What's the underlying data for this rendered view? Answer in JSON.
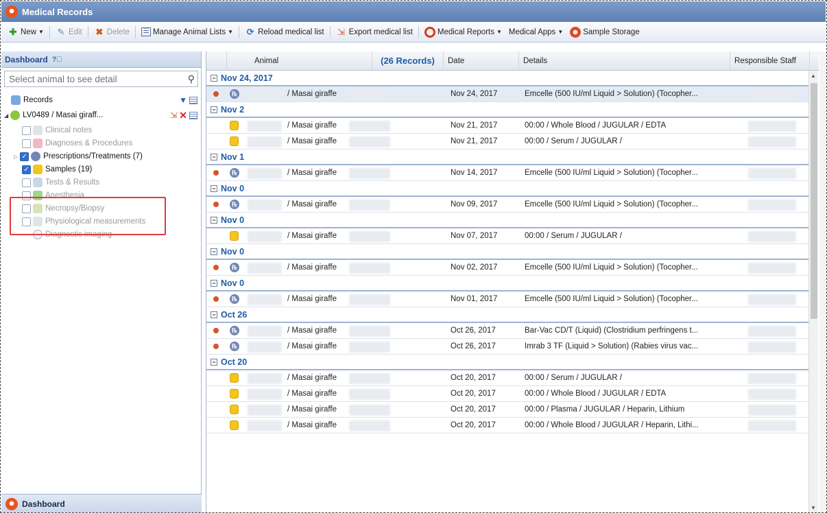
{
  "window": {
    "title": "Medical Records"
  },
  "toolbar": {
    "new": "New",
    "edit": "Edit",
    "delete": "Delete",
    "manage": "Manage Animal Lists",
    "reload": "Reload medical list",
    "export": "Export medical list",
    "reports": "Medical Reports",
    "apps": "Medical Apps",
    "storage": "Sample Storage"
  },
  "left": {
    "title": "Dashboard",
    "search_placeholder": "Select animal to see detail",
    "records_label": "Records",
    "animal_label": "LV0489 / Masai giraff...",
    "categories": [
      {
        "label": "Clinical notes",
        "checked": false
      },
      {
        "label": "Diagnoses & Procedures",
        "checked": false
      },
      {
        "label": "Prescriptions/Treatments (7)",
        "checked": true
      },
      {
        "label": "Samples (19)",
        "checked": true
      },
      {
        "label": "Tests & Results",
        "checked": false
      },
      {
        "label": "Anesthesia",
        "checked": false
      },
      {
        "label": "Necropsy/Biopsy",
        "checked": false
      },
      {
        "label": "Physiological measurements",
        "checked": false
      },
      {
        "label": "Diagnostic imaging",
        "checked": false
      }
    ],
    "footer": "Dashboard"
  },
  "grid": {
    "columns": {
      "animal": "Animal",
      "count": "(26 Records)",
      "date": "Date",
      "details": "Details",
      "staff": "Responsible Staff"
    },
    "groups": [
      {
        "label": "Nov 24, 2017",
        "rows": [
          {
            "type": "rx",
            "animal": "/ Masai giraffe",
            "date": "Nov 24, 2017",
            "details": "Emcelle (500 IU/ml Liquid > Solution) (Tocopher...",
            "selected": true
          }
        ]
      },
      {
        "label": "Nov 2",
        "rows": [
          {
            "type": "sample",
            "animal": "/ Masai giraffe",
            "date": "Nov 21, 2017",
            "details": "00:00 / Whole Blood / JUGULAR / EDTA"
          },
          {
            "type": "sample",
            "animal": "/ Masai giraffe",
            "date": "Nov 21, 2017",
            "details": "00:00 / Serum / JUGULAR /"
          }
        ]
      },
      {
        "label": "Nov 1",
        "rows": [
          {
            "type": "rx",
            "animal": "/ Masai giraffe",
            "date": "Nov 14, 2017",
            "details": "Emcelle (500 IU/ml Liquid > Solution) (Tocopher..."
          }
        ]
      },
      {
        "label": "Nov 0",
        "rows": [
          {
            "type": "rx",
            "animal": "/ Masai giraffe",
            "date": "Nov 09, 2017",
            "details": "Emcelle (500 IU/ml Liquid > Solution) (Tocopher..."
          }
        ]
      },
      {
        "label": "Nov 0",
        "rows": [
          {
            "type": "sample",
            "animal": "/ Masai giraffe",
            "date": "Nov 07, 2017",
            "details": "00:00 / Serum / JUGULAR /"
          }
        ]
      },
      {
        "label": "Nov 0",
        "rows": [
          {
            "type": "rx",
            "animal": "/ Masai giraffe",
            "date": "Nov 02, 2017",
            "details": "Emcelle (500 IU/ml Liquid > Solution) (Tocopher..."
          }
        ]
      },
      {
        "label": "Nov 0",
        "rows": [
          {
            "type": "rx",
            "animal": "/ Masai giraffe",
            "date": "Nov 01, 2017",
            "details": "Emcelle (500 IU/ml Liquid > Solution) (Tocopher..."
          }
        ]
      },
      {
        "label": "Oct 26",
        "rows": [
          {
            "type": "rx",
            "animal": "/ Masai giraffe",
            "date": "Oct 26, 2017",
            "details": "Bar-Vac CD/T (Liquid) (Clostridium perfringens t..."
          },
          {
            "type": "rx",
            "animal": "/ Masai giraffe",
            "date": "Oct 26, 2017",
            "details": "Imrab 3 TF (Liquid > Solution) (Rabies virus vac..."
          }
        ]
      },
      {
        "label": "Oct 20",
        "rows": [
          {
            "type": "sample",
            "animal": "/ Masai giraffe",
            "date": "Oct 20, 2017",
            "details": "00:00 / Serum / JUGULAR /"
          },
          {
            "type": "sample",
            "animal": "/ Masai giraffe",
            "date": "Oct 20, 2017",
            "details": "00:00 / Whole Blood / JUGULAR / EDTA"
          },
          {
            "type": "sample",
            "animal": "/ Masai giraffe",
            "date": "Oct 20, 2017",
            "details": "00:00 / Plasma / JUGULAR / Heparin, Lithium"
          },
          {
            "type": "sample",
            "animal": "/ Masai giraffe",
            "date": "Oct 20, 2017",
            "details": "00:00 / Whole Blood / JUGULAR / Heparin, Lithi..."
          }
        ]
      }
    ]
  },
  "colors": {
    "accent": "#1f5aa6",
    "titlebar": "#6b8bc0",
    "highlight": "#e23b3b",
    "rx": "#7186b4",
    "sample": "#f3c51d",
    "dot": "#d6542a"
  },
  "icons": [
    "app-logo-icon",
    "new-icon",
    "edit-icon",
    "delete-icon",
    "list-icon",
    "reload-icon",
    "export-icon",
    "report-icon",
    "storage-icon",
    "help-icon",
    "search-icon",
    "filter-icon",
    "grid-icon",
    "close-icon"
  ]
}
